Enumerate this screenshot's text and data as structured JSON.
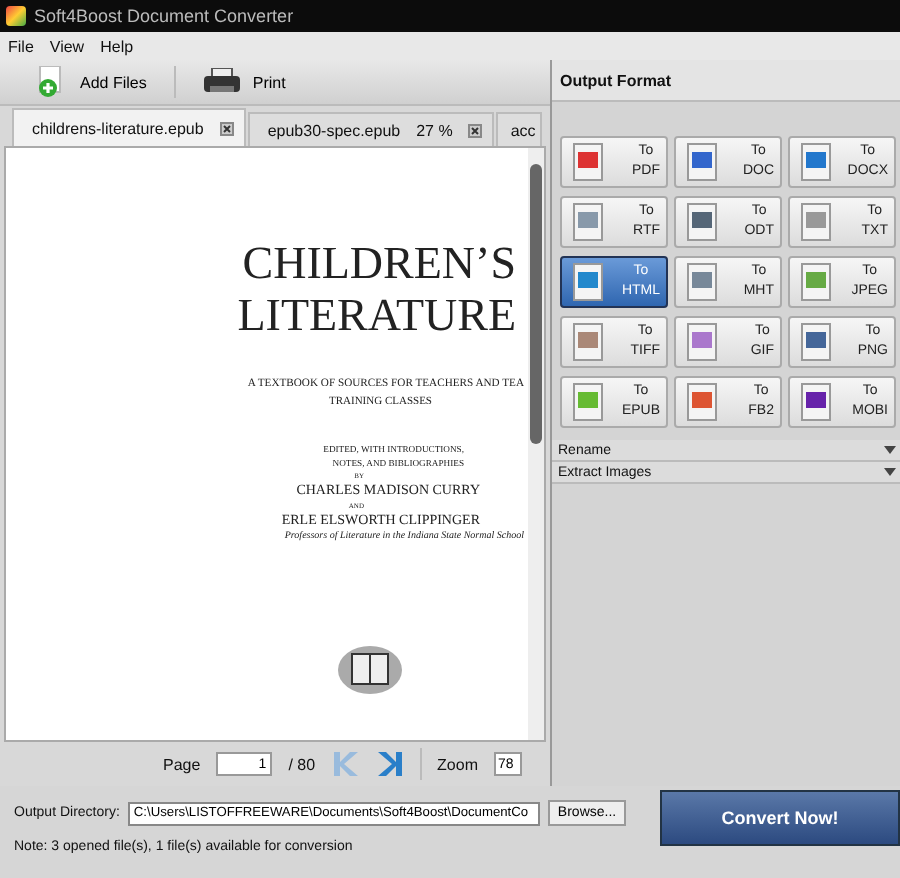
{
  "window": {
    "title": "Soft4Boost Document Converter"
  },
  "menu": [
    "File",
    "View",
    "Help"
  ],
  "toolbar": [
    {
      "kind": "add",
      "label": "Add Files"
    },
    {
      "kind": "print",
      "label": "Print"
    }
  ],
  "doc_tabs": [
    {
      "label": "childrens-literature.epub",
      "selected": true
    },
    {
      "label": "epub30-spec.epub",
      "progress": "27 %",
      "selected": false
    },
    {
      "label": "acc",
      "selected": false
    }
  ],
  "document": {
    "lines": [
      {
        "kind": "title",
        "text": "CHILDREN’S"
      },
      {
        "kind": "title",
        "text": "LITERATURE"
      },
      {
        "kind": "sub",
        "text": "A TEXTBOOK OF SOURCES FOR TEACHERS AND TEA"
      },
      {
        "kind": "sub2",
        "text": "TRAINING CLASSES"
      },
      {
        "kind": "small",
        "text": "EDITED, WITH INTRODUCTIONS,"
      },
      {
        "kind": "small",
        "text": "NOTES, AND BIBLIOGRAPHIES"
      },
      {
        "kind": "tiny",
        "text": "BY"
      },
      {
        "kind": "author",
        "text": "CHARLES MADISON CURRY"
      },
      {
        "kind": "tiny",
        "text": "AND"
      },
      {
        "kind": "author",
        "text": "ERLE ELSWORTH CLIPPINGER"
      },
      {
        "kind": "italic",
        "text": "Professors of Literature in the Indiana State Normal School"
      }
    ]
  },
  "pager": {
    "page_label": "Page",
    "page": "1",
    "total": "/ 80",
    "zoom_label": "Zoom",
    "zoom": "78"
  },
  "output_format": {
    "title": "Output Format",
    "formats": [
      {
        "prefix": "To",
        "name": "PDF",
        "selected": false
      },
      {
        "prefix": "To",
        "name": "DOC",
        "selected": false
      },
      {
        "prefix": "To",
        "name": "DOCX",
        "selected": false
      },
      {
        "prefix": "To",
        "name": "RTF",
        "selected": false
      },
      {
        "prefix": "To",
        "name": "ODT",
        "selected": false
      },
      {
        "prefix": "To",
        "name": "TXT",
        "selected": false
      },
      {
        "prefix": "To",
        "name": "HTML",
        "selected": true
      },
      {
        "prefix": "To",
        "name": "MHT",
        "selected": false
      },
      {
        "prefix": "To",
        "name": "JPEG",
        "selected": false
      },
      {
        "prefix": "To",
        "name": "TIFF",
        "selected": false
      },
      {
        "prefix": "To",
        "name": "GIF",
        "selected": false
      },
      {
        "prefix": "To",
        "name": "PNG",
        "selected": false
      },
      {
        "prefix": "To",
        "name": "EPUB",
        "selected": false
      },
      {
        "prefix": "To",
        "name": "FB2",
        "selected": false
      },
      {
        "prefix": "To",
        "name": "MOBI",
        "selected": false
      }
    ],
    "sections": [
      {
        "label": "Rename",
        "expanded": false
      },
      {
        "label": "Extract Images",
        "expanded": false
      }
    ]
  },
  "output": {
    "label": "Output Directory:",
    "value": "C:\\Users\\LISTOFFREEWARE\\Documents\\Soft4Boost\\DocumentCo",
    "browse": "Browse...",
    "convert": "Convert Now!"
  },
  "status_bar": "Note: 3 opened file(s), 1 file(s) available for conversion"
}
